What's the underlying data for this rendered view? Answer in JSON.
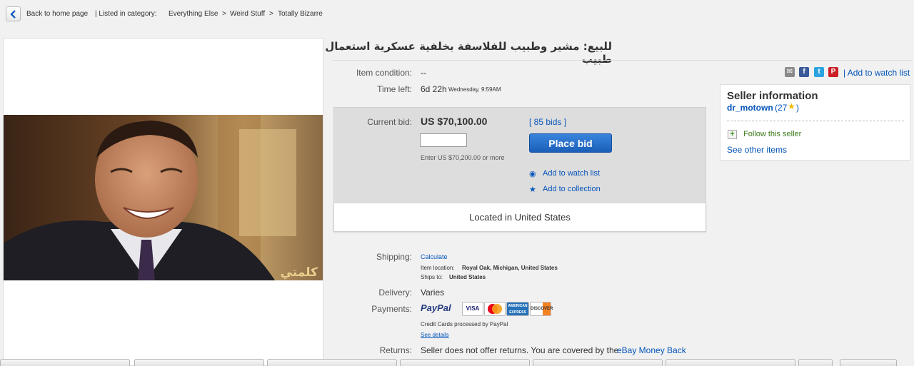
{
  "breadcrumb": {
    "back_label": "Back to home page",
    "listed_label": "| Listed in category:",
    "categories": [
      "Everything Else",
      "Weird Stuff",
      "Totally Bizarre"
    ],
    "separator": ">"
  },
  "listing": {
    "title": "للبيع: مشير وطبيب للفلاسفة بخلفية عسكرية استعمال طبيب",
    "condition_label": "Item condition:",
    "condition_value": "--",
    "time_left_label": "Time left:",
    "time_left_value": "6d 22h",
    "time_left_detail": "Wednesday, 9:59AM",
    "watermark": "كلمتي"
  },
  "share": {
    "icons": [
      "email-icon",
      "facebook-icon",
      "twitter-icon",
      "pinterest-icon"
    ],
    "watch_link": "| Add to watch list"
  },
  "bid": {
    "current_label": "Current bid:",
    "current_value": "US $70,100.00",
    "bids_count": "[ 85 bids ]",
    "input_value": "",
    "hint": "Enter US $70,200.00 or more",
    "place_bid_label": "Place bid",
    "watch_label": "Add to watch list",
    "collection_label": "Add to collection",
    "located": "Located in United States"
  },
  "seller": {
    "heading": "Seller information",
    "name": "dr_motown",
    "feedback": "(27",
    "feedback_close": ")",
    "follow": "Follow this seller",
    "other_items": "See other items"
  },
  "shipping": {
    "label": "Shipping:",
    "value": "Calculate",
    "location_label": "Item location:",
    "location_value": "Royal Oak, Michigan, United States",
    "ships_label": "Ships to:",
    "ships_value": "United States"
  },
  "delivery": {
    "label": "Delivery:",
    "value": "Varies"
  },
  "payments": {
    "label": "Payments:",
    "paypal": "PayPal",
    "cards": [
      "VISA",
      "",
      "AMERICAN EXPRESS",
      "DISCOVER"
    ],
    "note": "Credit Cards processed by PayPal",
    "details_link": "See details"
  },
  "returns": {
    "label": "Returns:",
    "value": "Seller does not offer returns. You are covered by the",
    "link": "eBay Money Back"
  },
  "colors": {
    "link": "#0654ba",
    "button": "#2a73cc",
    "paypal_dark": "#253b80",
    "paypal_light": "#179bd7"
  }
}
